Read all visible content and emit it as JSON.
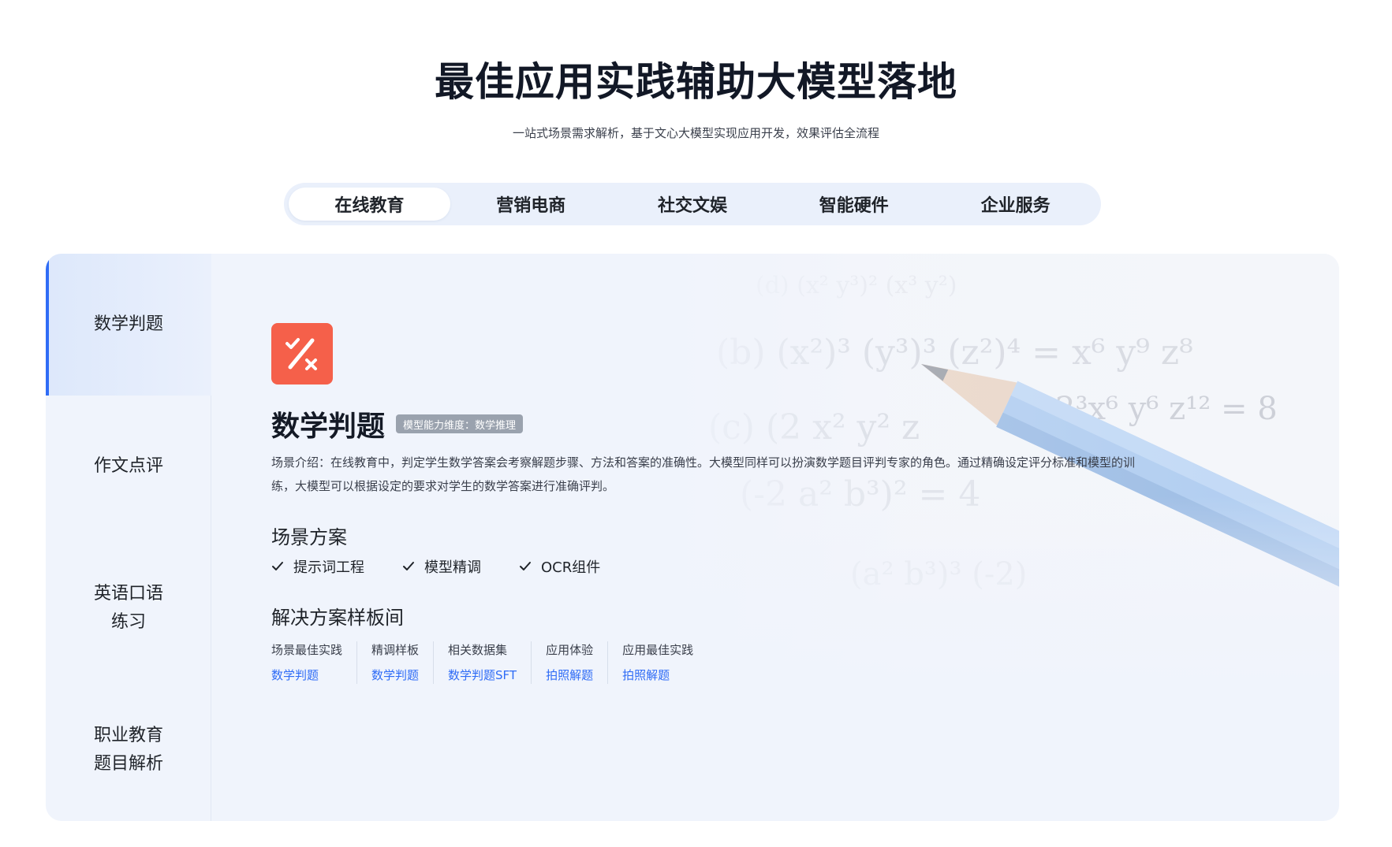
{
  "header": {
    "title": "最佳应用实践辅助大模型落地",
    "subtitle": "一站式场景需求解析，基于文心大模型实现应用开发，效果评估全流程"
  },
  "tabs": [
    {
      "label": "在线教育",
      "active": true
    },
    {
      "label": "营销电商",
      "active": false
    },
    {
      "label": "社交文娱",
      "active": false
    },
    {
      "label": "智能硬件",
      "active": false
    },
    {
      "label": "企业服务",
      "active": false
    }
  ],
  "sidebar": {
    "items": [
      {
        "label": "数学判题",
        "active": true
      },
      {
        "label": "作文点评",
        "active": false
      },
      {
        "label": "英语口语\n练习",
        "active": false
      },
      {
        "label": "职业教育\n题目解析",
        "active": false
      }
    ]
  },
  "scene": {
    "icon": "percent-check-cross-icon",
    "title": "数学判题",
    "badge": "模型能力维度：数学推理",
    "description": "场景介绍：在线教育中，判定学生数学答案会考察解题步骤、方法和答案的准确性。大模型同样可以扮演数学题目评判专家的角色。通过精确设定评分标准和模型的训练，大模型可以根据设定的要求对学生的数学答案进行准确评判。"
  },
  "solution_section": {
    "title": "场景方案",
    "items": [
      "提示词工程",
      "模型精调",
      "OCR组件"
    ]
  },
  "template_section": {
    "title": "解决方案样板间",
    "columns": [
      {
        "label": "场景最佳实践",
        "link": "数学判题"
      },
      {
        "label": "精调样板",
        "link": "数学判题"
      },
      {
        "label": "相关数据集",
        "link": "数学判题SFT"
      },
      {
        "label": "应用体验",
        "link": "拍照解题"
      },
      {
        "label": "应用最佳实践",
        "link": "拍照解题"
      }
    ]
  },
  "colors": {
    "accent": "#2f6cf6",
    "icon_bg": "#f5604a",
    "panel_bg": "#f0f4fc",
    "tabbar_bg": "#eaf0fb"
  }
}
